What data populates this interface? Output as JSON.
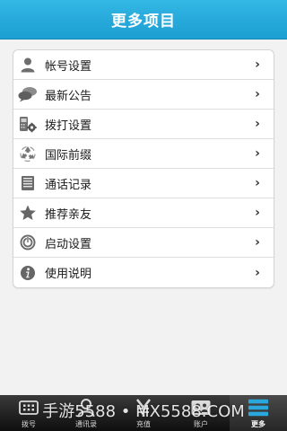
{
  "header": {
    "title": "更多项目"
  },
  "menu": {
    "items": [
      {
        "label": "帐号设置",
        "icon": "person-icon"
      },
      {
        "label": "最新公告",
        "icon": "speech-bubbles-icon"
      },
      {
        "label": "拨打设置",
        "icon": "phone-gear-icon"
      },
      {
        "label": "国际前缀",
        "icon": "recycle-icon"
      },
      {
        "label": "通话记录",
        "icon": "notebook-icon"
      },
      {
        "label": "推荐亲友",
        "icon": "star-icon"
      },
      {
        "label": "启动设置",
        "icon": "power-icon"
      },
      {
        "label": "使用说明",
        "icon": "info-icon"
      }
    ],
    "chevron": "›"
  },
  "tabbar": {
    "tabs": [
      {
        "label": "拨号",
        "icon": "keypad-icon"
      },
      {
        "label": "通讯录",
        "icon": "contacts-icon"
      },
      {
        "label": "充值",
        "icon": "yen-icon"
      },
      {
        "label": "账户",
        "icon": "account-icon"
      },
      {
        "label": "更多",
        "icon": "more-icon",
        "active": true
      }
    ]
  },
  "watermark": "手游5588 • MX5588.COM",
  "colors": {
    "header": "#1c9ed2",
    "tabbar": "#1a1a1a",
    "active_icon": "#2aa7dc"
  }
}
